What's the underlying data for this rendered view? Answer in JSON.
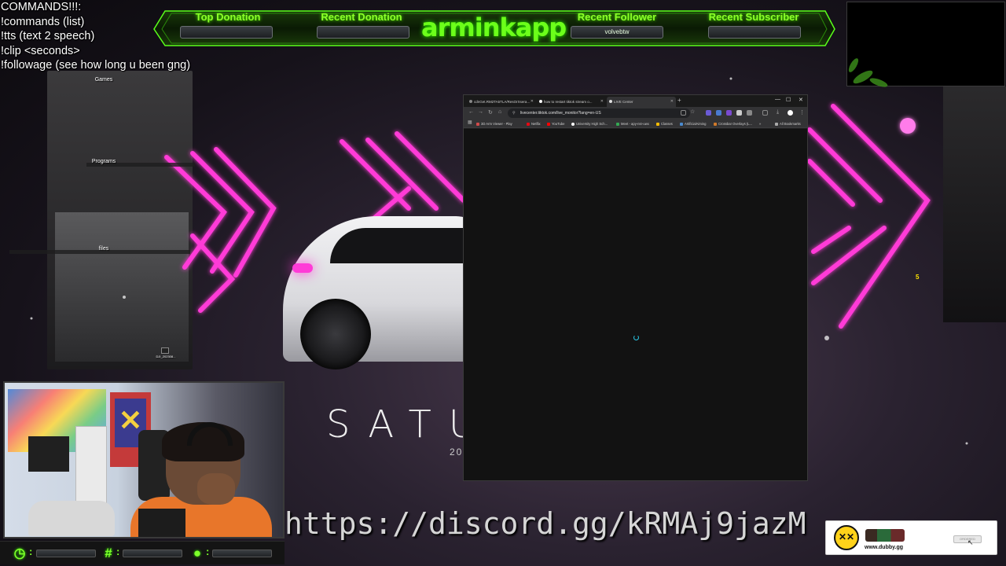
{
  "commands": {
    "title": "COMMANDS!!!:",
    "lines": [
      "!commands (list)",
      "!tts (text 2 speech)",
      "!clip <seconds>",
      "!followage (see how long u been gng)"
    ]
  },
  "stream_bar": {
    "channel_name": "arminkapp",
    "top_donation": {
      "label": "Top Donation",
      "value": ""
    },
    "recent_donation": {
      "label": "Recent Donation",
      "value": ""
    },
    "recent_follower": {
      "label": "Recent Follower",
      "value": "volvebtw"
    },
    "recent_subscriber": {
      "label": "Recent Subscriber",
      "value": ""
    }
  },
  "desktop": {
    "icons": [
      {
        "label": "Games"
      },
      {
        "label": "Programs"
      },
      {
        "label": "files"
      },
      {
        "label": "DJI_202308..."
      }
    ]
  },
  "browser": {
    "tabs": [
      {
        "title": "cdnGet.RM2TA5TLA/ResOrXsera..."
      },
      {
        "title": "how to restart tiktok stream o..."
      },
      {
        "title": "LIVE Center"
      }
    ],
    "new_tab": "+",
    "window_controls": [
      "—",
      "☐",
      "✕"
    ],
    "url": "livecenter.tiktok.com/live_monitor?lang=en-US",
    "bookmarks": [
      {
        "label": "3D Arm Viewer - Play",
        "color": "#d04a4a"
      },
      {
        "label": "Netflix",
        "color": "#e50914"
      },
      {
        "label": "YouTube",
        "color": "#ff0000"
      },
      {
        "label": "University High Sch...",
        "color": "#ffffff"
      },
      {
        "label": "Meet - apy-nsr-uwx",
        "color": "#34a853"
      },
      {
        "label": "Classes",
        "color": "#fbbc04"
      },
      {
        "label": "ArtificialAiming",
        "color": "#4a8ad0"
      },
      {
        "label": "Crossbar Overlays (L...",
        "color": "#d07a2a"
      }
    ],
    "bookmarks_more": "»",
    "all_bookmarks": "All Bookmarks"
  },
  "ticker": {
    "text": "https://discord.gg/kRMAj9jazM"
  },
  "background": {
    "brand_text": "SATU",
    "year_text": "20"
  },
  "sponsor": {
    "url": "www.dubby.gg",
    "button": "ORDERED"
  },
  "bottom_bar": {
    "clock_icon": "clock-icon",
    "hash_icon": "hashtag-icon",
    "user_icon": "user-icon"
  },
  "misc": {
    "yellow_marker": "5"
  },
  "colors": {
    "accent_green": "#6cff1a",
    "neon_pink": "#ff2bd6",
    "spinner": "#29c7e6"
  }
}
